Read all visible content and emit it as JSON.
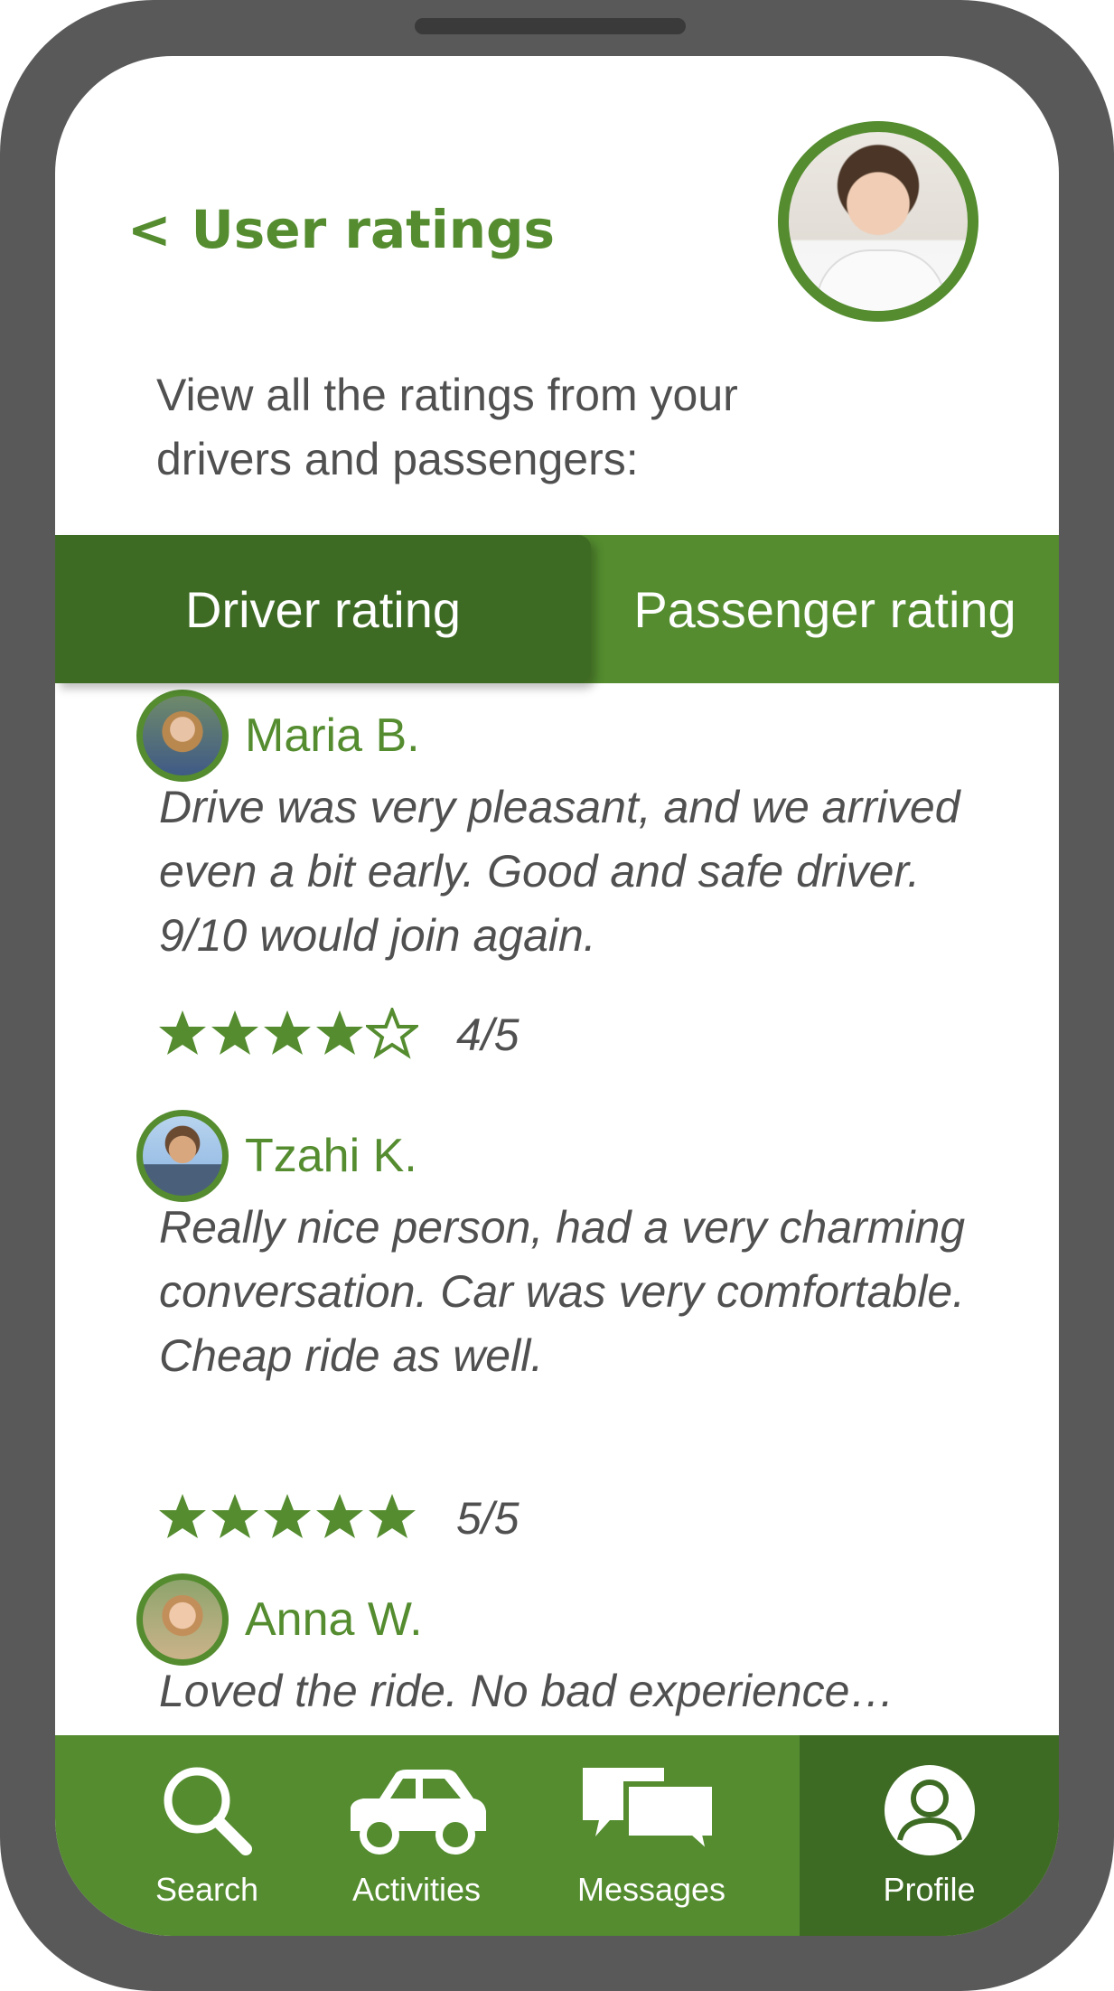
{
  "header": {
    "back_glyph": "<",
    "title": "User ratings"
  },
  "subtitle": "View all the ratings from your drivers and passengers:",
  "tabs": [
    {
      "label": "Driver rating",
      "selected": true
    },
    {
      "label": "Passenger rating",
      "selected": false
    }
  ],
  "reviews": [
    {
      "name": "Maria B.",
      "comment": "Drive was very pleasant, and we arrived even a bit early. Good and safe driver. 9/10 would join again.",
      "rating": 4,
      "score_text": "4/5"
    },
    {
      "name": "Tzahi K.",
      "comment": "Really nice person, had a very charming conversation. Car was very comfortable. Cheap ride as well.",
      "rating": 5,
      "score_text": "5/5"
    },
    {
      "name": "Anna W.",
      "comment": "Loved the ride. No bad experience…"
    }
  ],
  "navbar": {
    "items": [
      {
        "label": "Search",
        "icon": "search-icon"
      },
      {
        "label": "Activities",
        "icon": "car-icon"
      },
      {
        "label": "Messages",
        "icon": "chat-bubbles-icon"
      },
      {
        "label": "Profile",
        "icon": "user-circle-icon",
        "active": true
      }
    ]
  },
  "colors": {
    "accent": "#548c2f",
    "accent_dark": "#3e6b24",
    "text_gray": "#505050",
    "phone_frame": "#595959"
  }
}
